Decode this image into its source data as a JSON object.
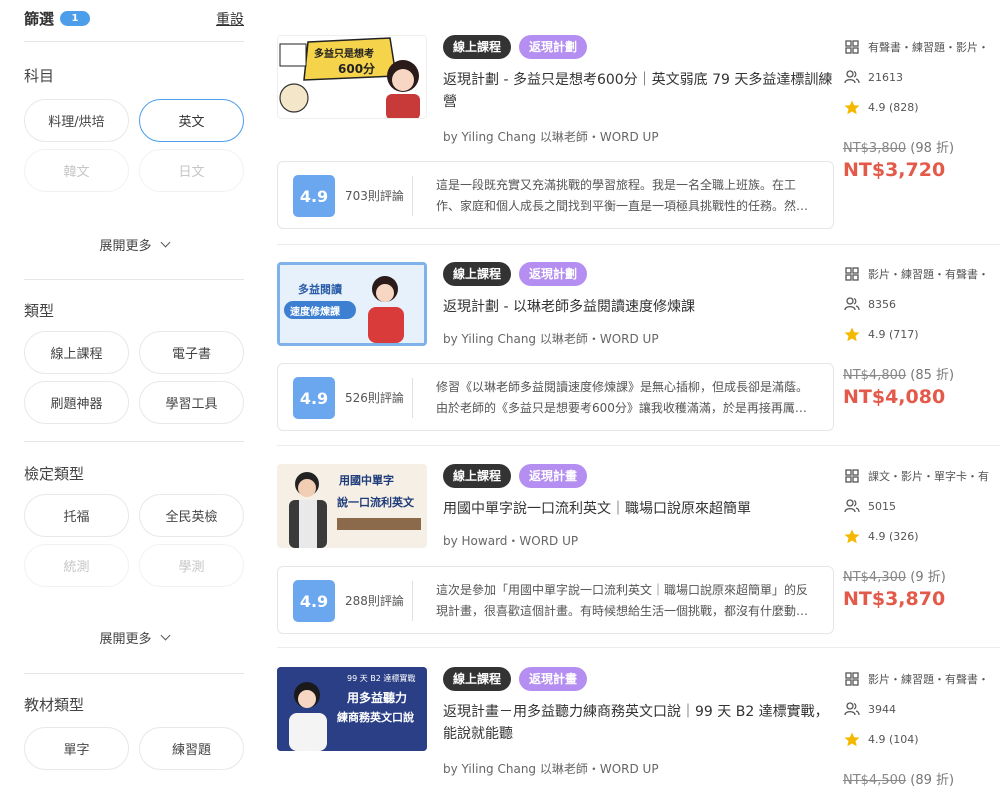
{
  "filter": {
    "title": "篩選",
    "count": "1",
    "reset": "重設"
  },
  "sections": {
    "subject": {
      "title": "科目",
      "chips": [
        "料理/烘培",
        "英文",
        "韓文",
        "日文"
      ],
      "expand": "展開更多"
    },
    "type": {
      "title": "類型",
      "chips": [
        "線上課程",
        "電子書",
        "刷題神器",
        "學習工具"
      ]
    },
    "exam": {
      "title": "檢定類型",
      "chips": [
        "托福",
        "全民英檢",
        "統測",
        "學測"
      ],
      "expand": "展開更多"
    },
    "material": {
      "title": "教材類型",
      "chips": [
        "單字",
        "練習題"
      ]
    }
  },
  "courses": [
    {
      "tags": [
        "線上課程",
        "返現計劃"
      ],
      "title": "返現計劃 - 多益只是想考600分｜英文弱底 79 天多益達標訓練營",
      "author": "by Yiling Chang 以琳老師・WORD UP",
      "rating": "4.9",
      "reviews": "703則評論",
      "review_lines": [
        "這是一段既充實又充滿挑戰的學習旅程。我是一名全職上班族。在工",
        "作、家庭和個人成長之間找到平衡一直是一項極具挑戰性的任務。然…"
      ],
      "features": "有聲書・練習題・影片・",
      "students": "21613",
      "score": "4.9 (828)",
      "price_old": "NT$3,800",
      "discount": "(98 折)",
      "price_new": "NT$3,720",
      "thumb_text": [
        "多益只是想考",
        "600分"
      ],
      "thumb_bg": "#ffffff"
    },
    {
      "tags": [
        "線上課程",
        "返現計劃"
      ],
      "title": "返現計劃 - 以琳老師多益閱讀速度修煉課",
      "author": "by Yiling Chang 以琳老師・WORD UP",
      "rating": "4.9",
      "reviews": "526則評論",
      "review_lines": [
        "修習《以琳老師多益閱讀速度修煉課》是無心插柳，但成長卻是滿蔭。",
        "由於老師的《多益只是想要考600分》讓我收穫滿滿，於是再接再厲體…"
      ],
      "features": "影片・練習題・有聲書・",
      "students": "8356",
      "score": "4.9 (717)",
      "price_old": "NT$4,800",
      "discount": "(85 折)",
      "price_new": "NT$4,080",
      "thumb_text": [
        "多益閱讀",
        "速度修煉課"
      ],
      "thumb_bg": "#e7f1fb"
    },
    {
      "tags": [
        "線上課程",
        "返現計畫"
      ],
      "title": "用國中單字說一口流利英文｜職場口說原來超簡單",
      "author": "by Howard・WORD UP",
      "rating": "4.9",
      "reviews": "288則評論",
      "review_lines": [
        "這次是參加「用國中單字說一口流利英文｜職場口說原來超簡單」的反",
        "現計畫，很喜歡這個計畫。有時候想給生活一個挑戰，都沒有什麼動…"
      ],
      "features": "課文・影片・單字卡・有",
      "students": "5015",
      "score": "4.9 (326)",
      "price_old": "NT$4,300",
      "discount": "(9 折)",
      "price_new": "NT$3,870",
      "thumb_text": [
        "用國中單字",
        "說一口流利英文"
      ],
      "thumb_bg": "#f6efe6"
    },
    {
      "tags": [
        "線上課程",
        "返現計畫"
      ],
      "title": "返現計畫－用多益聽力練商務英文口說｜99 天 B2 達標實戰，能說就能聽",
      "author": "by Yiling Chang 以琳老師・WORD UP",
      "rating": "",
      "reviews": "",
      "review_lines": [],
      "features": "影片・練習題・有聲書・",
      "students": "3944",
      "score": "4.9 (104)",
      "price_old": "NT$4,500",
      "discount": "(89 折)",
      "price_new": "",
      "thumb_text": [
        "99 天 B2 達標實戰",
        "用多益聽力",
        "練商務英文口說"
      ],
      "thumb_bg": "#2b3f86"
    }
  ],
  "colors": {
    "accent": "#4c9eea",
    "price": "#e45a4a",
    "tag_dark": "#333333",
    "tag_purple": "#b48ef0",
    "rating_box": "#6aa7ee",
    "star": "#f5b800"
  }
}
